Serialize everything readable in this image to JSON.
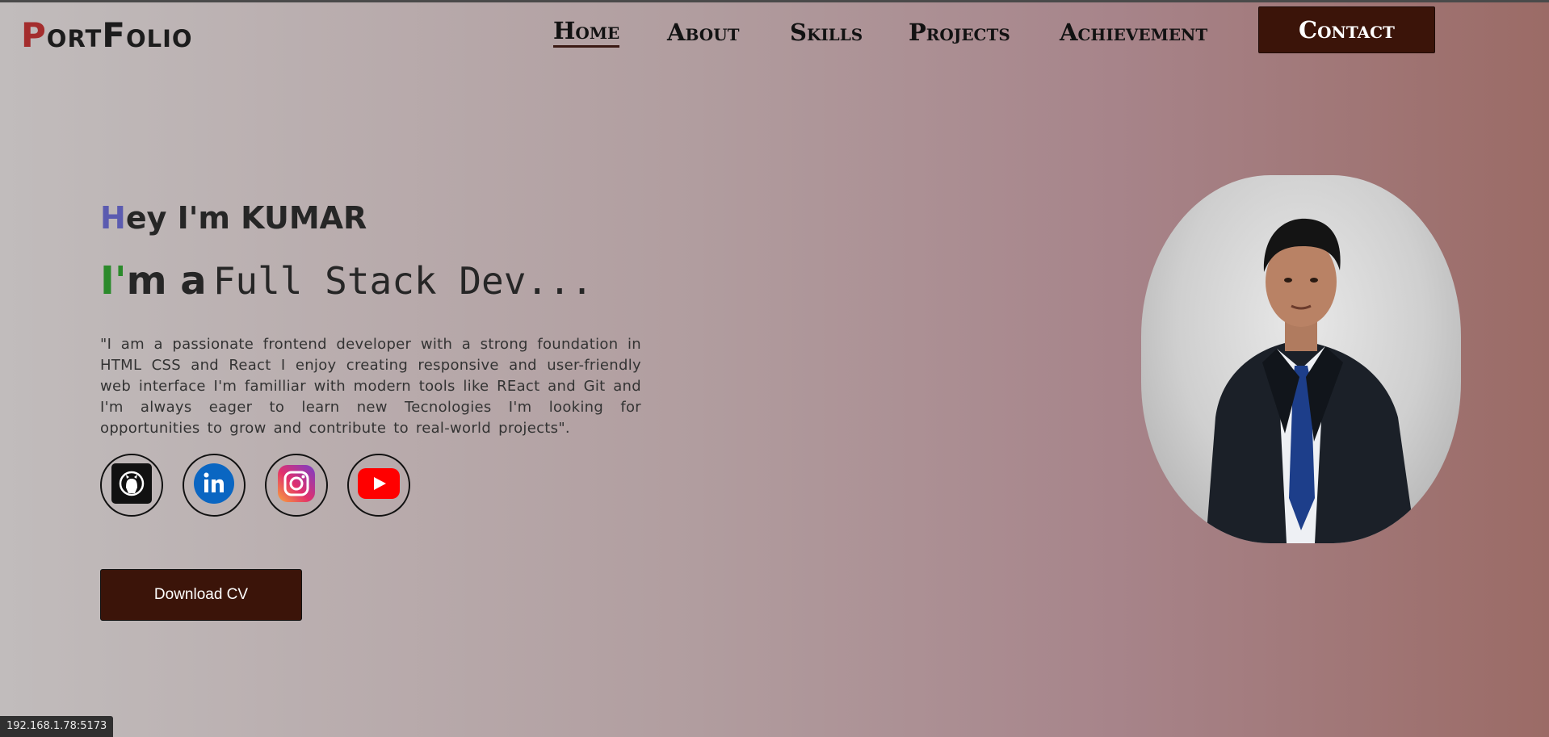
{
  "header": {
    "logo_first": "P",
    "logo_rest": "ortFolio",
    "nav": [
      {
        "label": "Home",
        "active": true
      },
      {
        "label": "About"
      },
      {
        "label": "Skills"
      },
      {
        "label": "Projects"
      },
      {
        "label": "Achievement"
      }
    ],
    "contact_label": "Contact"
  },
  "hero": {
    "greet_first": "H",
    "greet_rest": "ey I'm KUMAR",
    "role_prefix_first": "I'",
    "role_prefix_rest": "m a",
    "role_typed": "Full Stack Dev...",
    "bio": "\"I am a passionate frontend developer with a strong foundation in HTML CSS and React I enjoy creating responsive and user-friendly web interface I'm familliar with modern tools like REact and Git and I'm always eager to learn new Tecnologies I'm looking for opportunities to grow and contribute to real-world projects\".",
    "socials": [
      {
        "icon": "github-icon"
      },
      {
        "icon": "linkedin-icon"
      },
      {
        "icon": "instagram-icon"
      },
      {
        "icon": "youtube-icon"
      }
    ],
    "download_label": "Download CV",
    "accent_colors": {
      "greet": "#5b5bb0",
      "role": "#2b8a2b",
      "logo": "#a42d2d",
      "button": "#3b1409"
    }
  },
  "status_bar": {
    "url": "192.168.1.78:5173"
  }
}
